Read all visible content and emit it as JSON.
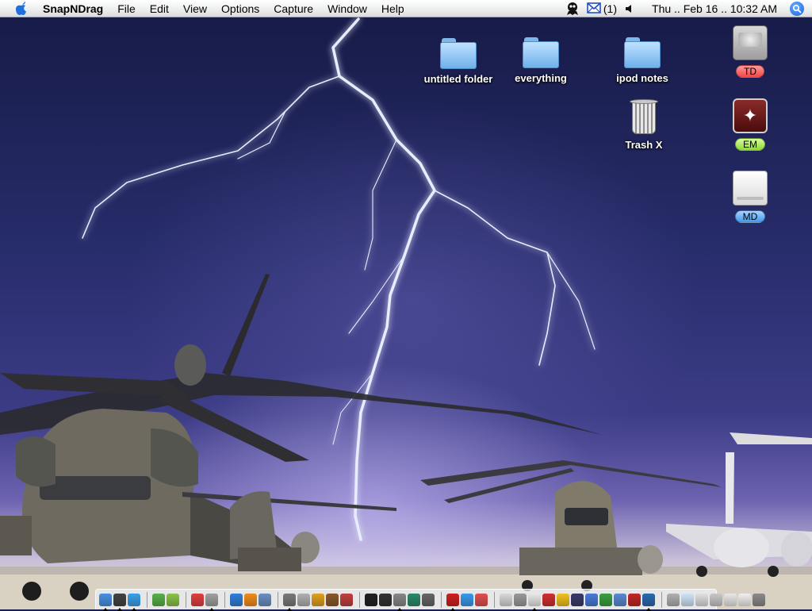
{
  "menubar": {
    "app_name": "SnapNDrag",
    "menus": [
      "File",
      "Edit",
      "View",
      "Options",
      "Capture",
      "Window",
      "Help"
    ],
    "mail_count": "(1)",
    "clock": "Thu .. Feb 16 .. 10:32 AM"
  },
  "desktop": {
    "items": [
      {
        "label": "untitled folder",
        "icon": "folder-icon"
      },
      {
        "label": "everything",
        "icon": "folder-icon"
      },
      {
        "label": "ipod notes",
        "icon": "folder-icon"
      },
      {
        "label": "Trash X",
        "icon": "trash-icon"
      }
    ],
    "drives": [
      {
        "label": "TD",
        "icon": "hard-drive-icon",
        "color": "#f04646"
      },
      {
        "label": "EM",
        "icon": "firewire-drive-icon",
        "color": "#8ed53a"
      },
      {
        "label": "MD",
        "icon": "removable-drive-icon",
        "color": "#3e96ee"
      }
    ]
  },
  "dock": {
    "groups": [
      [
        {
          "icon": "finder-icon",
          "color": "#4a90e2",
          "running": true
        },
        {
          "icon": "dashboard-icon",
          "color": "#444444",
          "running": true
        },
        {
          "icon": "safari-icon",
          "color": "#3aa0e8",
          "running": true
        }
      ],
      [
        {
          "icon": "itunes-icon",
          "color": "#5ab04a",
          "running": false
        },
        {
          "icon": "music-icon",
          "color": "#8bc34a",
          "running": false
        }
      ],
      [
        {
          "icon": "ical-icon",
          "color": "#e04040",
          "running": false
        },
        {
          "icon": "iphoto-icon",
          "color": "#a0a0a0",
          "running": true
        }
      ],
      [
        {
          "icon": "ie-icon",
          "color": "#2f7fd8",
          "running": false
        },
        {
          "icon": "vlc-icon",
          "color": "#f08c1c",
          "running": false
        },
        {
          "icon": "network-icon",
          "color": "#6a8fc0",
          "running": false
        }
      ],
      [
        {
          "icon": "utility-icon",
          "color": "#7a7a7a",
          "running": true
        },
        {
          "icon": "disk-icon",
          "color": "#b0b0b0",
          "running": false
        },
        {
          "icon": "game-icon",
          "color": "#e0a020",
          "running": false
        },
        {
          "icon": "app-icon",
          "color": "#8a5a2a",
          "running": false
        },
        {
          "icon": "card-icon",
          "color": "#c04040",
          "running": false
        }
      ],
      [
        {
          "icon": "terminal-icon",
          "color": "#222222",
          "running": false
        },
        {
          "icon": "console-icon",
          "color": "#333333",
          "running": false
        },
        {
          "icon": "tools-icon",
          "color": "#888888",
          "running": true
        },
        {
          "icon": "globe-icon",
          "color": "#2a8a6a",
          "running": false
        },
        {
          "icon": "printer-icon",
          "color": "#666666",
          "running": false
        }
      ],
      [
        {
          "icon": "acrobat-icon",
          "color": "#d02020",
          "running": true
        },
        {
          "icon": "ichat-icon",
          "color": "#3a9ae8",
          "running": false
        },
        {
          "icon": "tool-icon",
          "color": "#e05050",
          "running": false
        }
      ],
      [
        {
          "icon": "textedit-icon",
          "color": "#d8d8d8",
          "running": false
        },
        {
          "icon": "preview-icon",
          "color": "#9a9a9a",
          "running": false
        },
        {
          "icon": "document-icon",
          "color": "#e8e8e8",
          "running": true
        },
        {
          "icon": "red-icon",
          "color": "#d03030",
          "running": false
        },
        {
          "icon": "warning-icon",
          "color": "#f0c020",
          "running": false
        },
        {
          "icon": "mortarboard-icon",
          "color": "#3a3a6a",
          "running": false
        },
        {
          "icon": "ftp-icon",
          "color": "#4a7ad8",
          "running": false
        },
        {
          "icon": "green-icon",
          "color": "#3aa040",
          "running": false
        },
        {
          "icon": "monitor-icon",
          "color": "#5a8ad0",
          "running": false
        },
        {
          "icon": "red-app-icon",
          "color": "#c02828",
          "running": false
        },
        {
          "icon": "world-icon",
          "color": "#2a6ab0",
          "running": true
        }
      ],
      [
        {
          "icon": "magnifier-icon",
          "color": "#b0b0b0",
          "running": false
        },
        {
          "icon": "window-icon",
          "color": "#d0e4f8",
          "running": false
        },
        {
          "icon": "window-icon",
          "color": "#e0e0e0",
          "running": false
        },
        {
          "icon": "window-icon",
          "color": "#c8c8c8",
          "running": false
        },
        {
          "icon": "window-icon",
          "color": "#e8e8e8",
          "running": false
        },
        {
          "icon": "window-icon",
          "color": "#f0f0f0",
          "running": false
        },
        {
          "icon": "trash-icon",
          "color": "#8a8a8a",
          "running": false
        }
      ]
    ]
  }
}
